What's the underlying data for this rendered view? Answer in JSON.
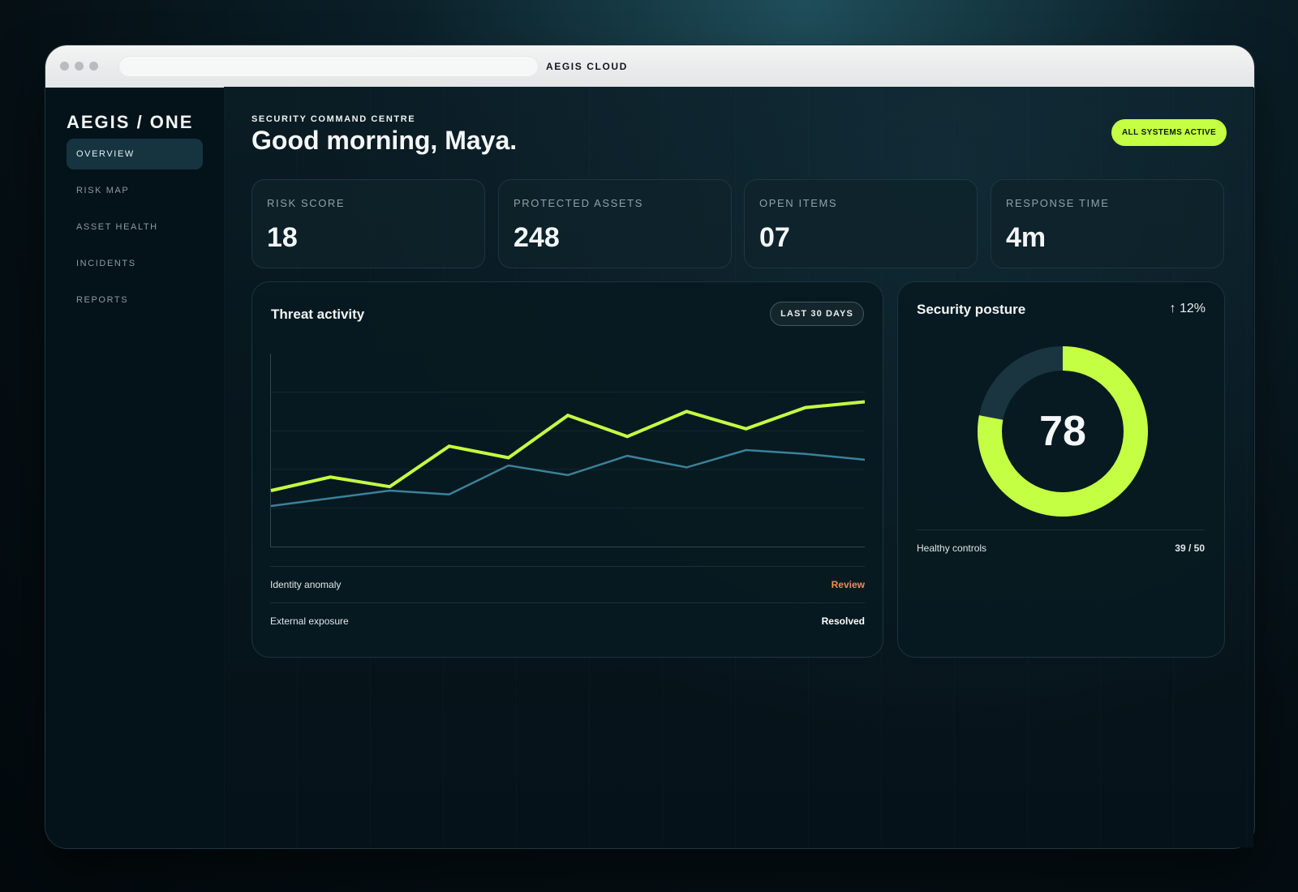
{
  "window": {
    "app_title": "AEGIS CLOUD"
  },
  "sidebar": {
    "brand": "AEGIS / ONE",
    "items": [
      {
        "label": "OVERVIEW",
        "active": true
      },
      {
        "label": "RISK MAP"
      },
      {
        "label": "ASSET HEALTH"
      },
      {
        "label": "INCIDENTS"
      },
      {
        "label": "REPORTS"
      }
    ]
  },
  "header": {
    "eyebrow": "SECURITY COMMAND CENTRE",
    "greeting": "Good morning, Maya.",
    "status_badge": "ALL SYSTEMS ACTIVE"
  },
  "stats": [
    {
      "label": "RISK SCORE",
      "value": "18"
    },
    {
      "label": "PROTECTED ASSETS",
      "value": "248"
    },
    {
      "label": "OPEN ITEMS",
      "value": "07"
    },
    {
      "label": "RESPONSE TIME",
      "value": "4m"
    }
  ],
  "threat_panel": {
    "title": "Threat activity",
    "range_button": "LAST 30 DAYS",
    "items": [
      {
        "name": "Identity anomaly",
        "status": "Review",
        "status_color": "#f08a5d"
      },
      {
        "name": "External exposure",
        "status": "Resolved",
        "status_color": "#ffffff"
      }
    ]
  },
  "posture_panel": {
    "title": "Security posture",
    "delta": "↑ 12%",
    "score": "78",
    "metric_label": "Healthy controls",
    "metric_value": "39 / 50"
  },
  "colors": {
    "accent": "#c4ff43",
    "secondary_series": "#3c8199",
    "warning": "#f08a5d"
  },
  "chart_data": [
    {
      "type": "line",
      "x": [
        1,
        2,
        3,
        4,
        5,
        6,
        7,
        8,
        9,
        10,
        11
      ],
      "series": [
        {
          "values": [
            29,
            36,
            31,
            52,
            46,
            68,
            57,
            70,
            61,
            72,
            75
          ],
          "color": "#c4ff43"
        },
        {
          "values": [
            21,
            25,
            29,
            27,
            42,
            37,
            47,
            41,
            50,
            48,
            45
          ],
          "color": "#3c8199"
        }
      ],
      "ylim": [
        0,
        100
      ],
      "grid": true
    },
    {
      "type": "pie",
      "categories": [
        "score",
        "remaining"
      ],
      "values": [
        78,
        22
      ],
      "colors": [
        "#c4ff43",
        "#1a3440"
      ]
    }
  ]
}
